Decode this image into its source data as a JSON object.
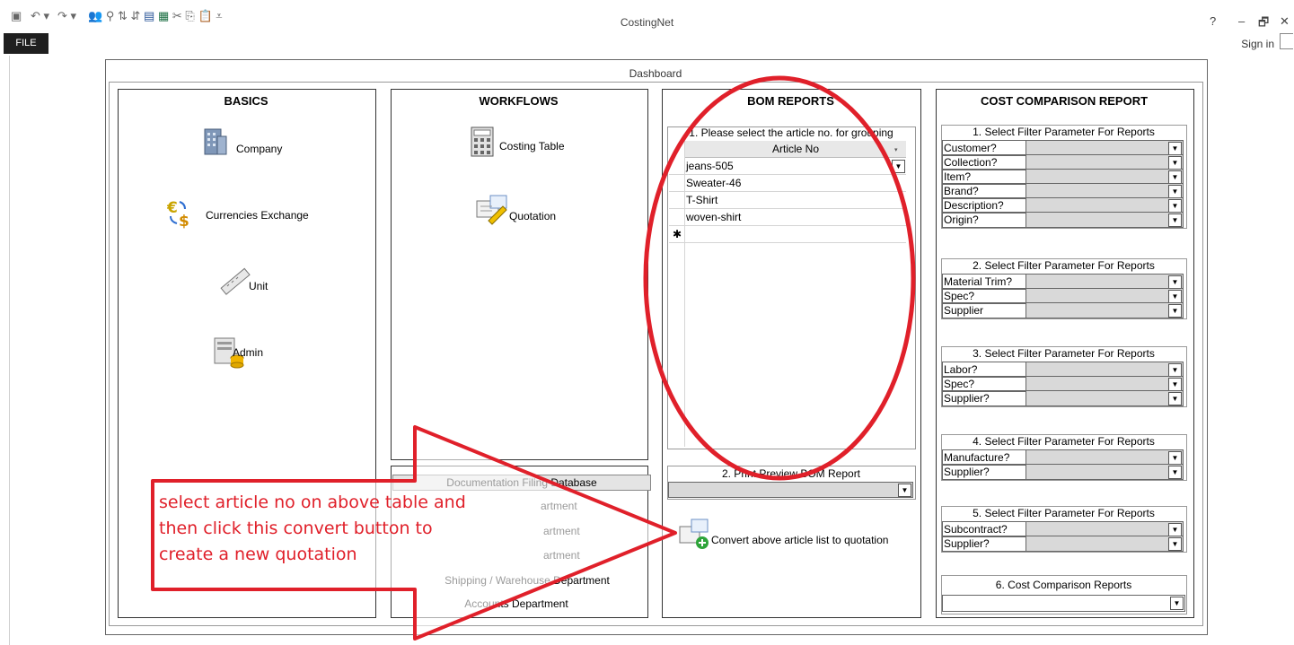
{
  "app": {
    "title": "CostingNet",
    "file_label": "FILE",
    "sign_in": "Sign in",
    "help": "?",
    "minimize": "–",
    "restore": "🗗",
    "close": "✕"
  },
  "dashboard": {
    "title": "Dashboard"
  },
  "basics": {
    "title": "BASICS",
    "items": [
      {
        "label": "Company",
        "icon": "building-icon"
      },
      {
        "label": "Currencies Exchange",
        "icon": "currency-icon"
      },
      {
        "label": "Unit",
        "icon": "ruler-icon"
      },
      {
        "label": "Admin",
        "icon": "admin-icon"
      }
    ]
  },
  "workflows": {
    "title": "WORKFLOWS",
    "items": [
      {
        "label": "Costing Table",
        "icon": "calculator-icon"
      },
      {
        "label": "Quotation",
        "icon": "quotation-icon"
      }
    ],
    "docs": {
      "title": "Documentation Filing Database",
      "items": [
        "artment",
        "artment",
        "artment",
        "Shipping / Warehouse Department",
        "Accounts Department"
      ]
    }
  },
  "bom": {
    "title": "BOM REPORTS",
    "section1": "1. Please select the article no. for grouping",
    "column": "Article No",
    "rows": [
      "jeans-505",
      "Sweater-46",
      "T-Shirt",
      "woven-shirt"
    ],
    "new_row_marker": "✱",
    "section2": "2. Print Preview BOM Report",
    "convert_label": "Convert above article list to quotation"
  },
  "cost": {
    "title": "COST COMPARISON REPORT",
    "groups": [
      {
        "title": "1. Select Filter Parameter For Reports",
        "fields": [
          "Customer?",
          "Collection?",
          "Item?",
          "Brand?",
          "Description?",
          "Origin?"
        ]
      },
      {
        "title": "2. Select Filter Parameter For Reports",
        "fields": [
          "Material Trim?",
          "Spec?",
          "Supplier"
        ]
      },
      {
        "title": "3. Select Filter Parameter For Reports",
        "fields": [
          "Labor?",
          "Spec?",
          "Supplier?"
        ]
      },
      {
        "title": "4. Select Filter Parameter For Reports",
        "fields": [
          "Manufacture?",
          "Supplier?"
        ]
      },
      {
        "title": "5. Select Filter Parameter For Reports",
        "fields": [
          "Subcontract?",
          "Supplier?"
        ]
      }
    ],
    "reports_title": "6. Cost Comparison Reports"
  },
  "annotation": {
    "lines": [
      "select article no on above table and",
      "then click this convert button to",
      "create a new quotation"
    ],
    "color": "#e0202a"
  }
}
